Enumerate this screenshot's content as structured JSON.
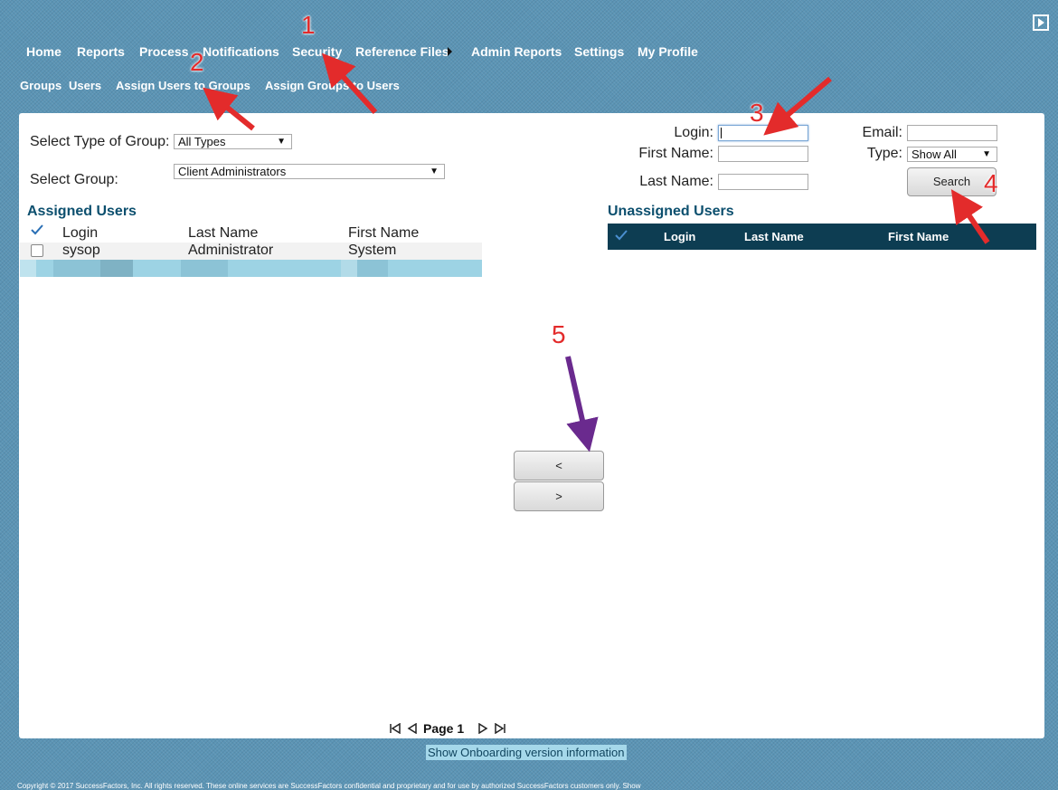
{
  "nav": {
    "items": [
      "Home",
      "Reports",
      "Process",
      "Notifications",
      "Security",
      "Reference Files",
      "Admin Reports",
      "Settings",
      "My Profile"
    ]
  },
  "subnav": {
    "items": [
      "Groups",
      "Users",
      "Assign Users to Groups",
      "Assign Groups to Users"
    ]
  },
  "left": {
    "type_label": "Select Type of Group:",
    "type_value": "All Types",
    "group_label": "Select Group:",
    "group_value": "Client Administrators",
    "assigned_title": "Assigned Users",
    "columns": [
      "Login",
      "Last Name",
      "First Name"
    ],
    "rows": [
      {
        "login": "sysop",
        "last": "Administrator",
        "first": "System"
      }
    ]
  },
  "search": {
    "login_label": "Login:",
    "first_label": "First Name:",
    "last_label": "Last Name:",
    "email_label": "Email:",
    "type_label": "Type:",
    "type_value": "Show All",
    "search_button": "Search"
  },
  "right": {
    "unassigned_title": "Unassigned Users",
    "columns": [
      "Login",
      "Last Name",
      "First Name"
    ]
  },
  "move": {
    "left_label": "<",
    "right_label": ">"
  },
  "pager": {
    "label": "Page 1"
  },
  "footer": {
    "version_link": "Show Onboarding version information",
    "copyright": "Copyright © 2017 SuccessFactors, Inc. All rights reserved. These online services are SuccessFactors confidential and proprietary and for use by authorized SuccessFactors customers only. Show"
  },
  "annotations": [
    "1",
    "2",
    "3",
    "4",
    "5"
  ],
  "colors": {
    "background": "#5b94b5",
    "header_dark": "#0d3d52",
    "title_blue": "#0c4f6e",
    "arrow_red": "#e32b2b",
    "arrow_purple": "#6a2a8e"
  }
}
